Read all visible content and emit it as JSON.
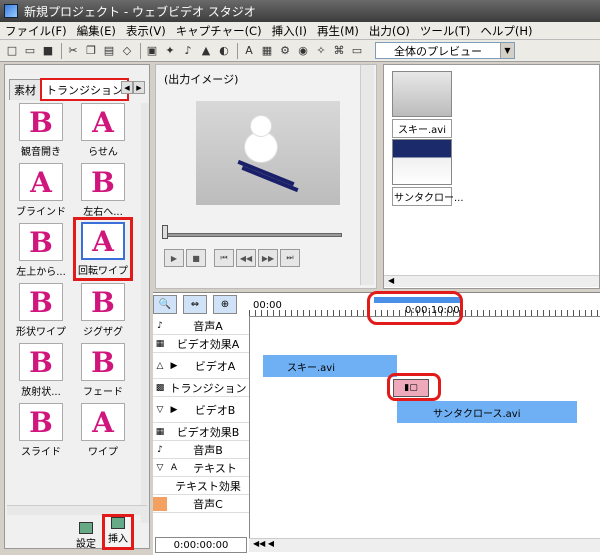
{
  "window": {
    "title": "新規プロジェクト - ウェブビデオ スタジオ"
  },
  "menu": [
    "ファイル(F)",
    "編集(E)",
    "表示(V)",
    "キャプチャー(C)",
    "挿入(I)",
    "再生(M)",
    "出力(O)",
    "ツール(T)",
    "ヘルプ(H)"
  ],
  "toolbar": {
    "preview_select": "全体のプレビュー"
  },
  "left": {
    "tabs": [
      "素材",
      "トランジション"
    ],
    "items": [
      {
        "label": "観音開き",
        "glyph": "B"
      },
      {
        "label": "らせん",
        "glyph": "A"
      },
      {
        "label": "ブラインド",
        "glyph": "A"
      },
      {
        "label": "左右へ...",
        "glyph": "B"
      },
      {
        "label": "左上から...",
        "glyph": "B"
      },
      {
        "label": "回転ワイプ",
        "glyph": "A"
      },
      {
        "label": "形状ワイプ",
        "glyph": "B"
      },
      {
        "label": "ジグザグ",
        "glyph": "B"
      },
      {
        "label": "放射状...",
        "glyph": "B"
      },
      {
        "label": "フェード",
        "glyph": "B"
      },
      {
        "label": "スライド",
        "glyph": "B"
      },
      {
        "label": "ワイプ",
        "glyph": "A"
      }
    ],
    "settings": "設定",
    "insert": "挿入"
  },
  "preview": {
    "caption": "(出力イメージ)"
  },
  "media": [
    {
      "label": "スキー.avi"
    },
    {
      "label": "サンタクロー..."
    }
  ],
  "timeline": {
    "ruler_start": "00:00",
    "range_label": "0:00:10:00",
    "tracks": [
      "音声A",
      "ビデオ効果A",
      "ビデオA",
      "トランジション",
      "ビデオB",
      "ビデオ効果B",
      "音声B",
      "テキスト",
      "テキスト効果",
      "音声C"
    ],
    "clip_a": "スキー.avi",
    "clip_b": "サンタクロース.avi",
    "timecode": "0:00:00:00"
  },
  "colors": {
    "highlight": "#e21a1a",
    "clip": "#6fb0f5",
    "range": "#4a90e8"
  }
}
